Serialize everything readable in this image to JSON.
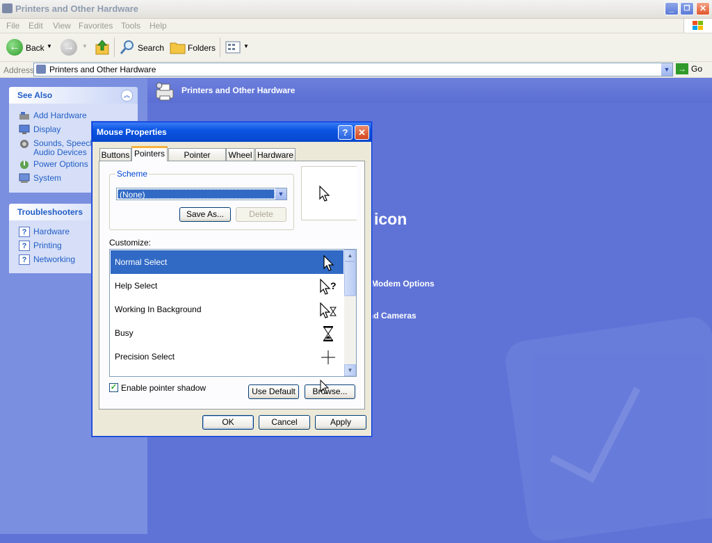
{
  "window": {
    "title": "Printers and Other Hardware",
    "minimize": "_",
    "restore": "❐",
    "close": "✕"
  },
  "menu": [
    "File",
    "Edit",
    "View",
    "Favorites",
    "Tools",
    "Help"
  ],
  "toolbar": {
    "back_label": "Back",
    "search_label": "Search",
    "folders_label": "Folders"
  },
  "address": {
    "label": "Address",
    "value": "Printers and Other Hardware",
    "go_label": "Go"
  },
  "see_also": {
    "title": "See Also",
    "items": [
      {
        "label": "Add Hardware"
      },
      {
        "label": "Display"
      },
      {
        "label": "Sounds, Speech,",
        "label2": "Audio Devices"
      },
      {
        "label": "Power Options"
      },
      {
        "label": "System"
      }
    ]
  },
  "troubleshooters": {
    "title": "Troubleshooters",
    "items": [
      "Hardware",
      "Printing",
      "Networking"
    ]
  },
  "content": {
    "title": "Printers and Other Hardware",
    "behind_heading": "icon",
    "behind_items": [
      "Modem Options",
      "nd Cameras"
    ]
  },
  "dialog": {
    "title": "Mouse Properties",
    "help": "?",
    "close": "✕",
    "tabs": [
      "Buttons",
      "Pointers",
      "Pointer Options",
      "Wheel",
      "Hardware"
    ],
    "active_tab": "Pointers",
    "scheme_label": "Scheme",
    "scheme_value": "(None)",
    "save_as": "Save As...",
    "delete": "Delete",
    "customize_label": "Customize:",
    "pointers": [
      "Normal Select",
      "Help Select",
      "Working In Background",
      "Busy",
      "Precision Select"
    ],
    "enable_shadow_label": "Enable pointer shadow",
    "enable_shadow_checked": true,
    "use_default": "Use Default",
    "browse": "Browse...",
    "ok": "OK",
    "cancel": "Cancel",
    "apply": "Apply"
  },
  "colors": {
    "xp_blue": "#0a54e3",
    "selection": "#316ac5",
    "link": "#215dc6",
    "background": "#5f73d7"
  }
}
